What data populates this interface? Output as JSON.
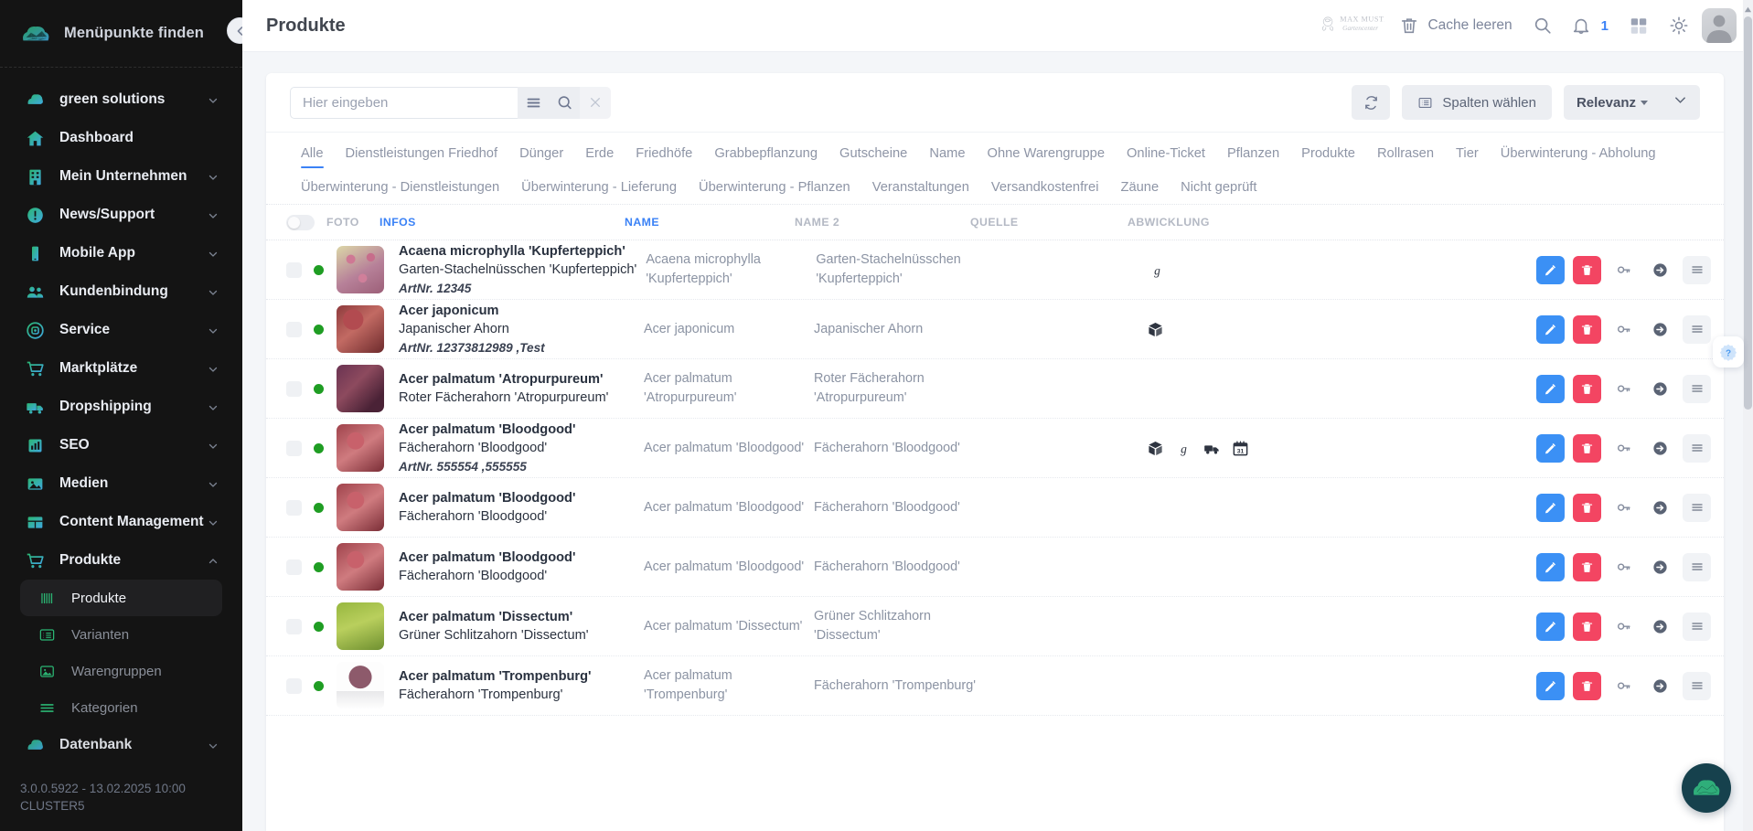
{
  "sidebar": {
    "brand_label": "Menüpunkte finden",
    "items": [
      {
        "label": "green solutions",
        "icon": "cloud-icon",
        "expandable": true
      },
      {
        "label": "Dashboard",
        "icon": "home-icon",
        "expandable": false
      },
      {
        "label": "Mein Unternehmen",
        "icon": "building-icon",
        "expandable": true
      },
      {
        "label": "News/Support",
        "icon": "exclamation-circle-icon",
        "expandable": true
      },
      {
        "label": "Mobile App",
        "icon": "mobile-icon",
        "expandable": true
      },
      {
        "label": "Kundenbindung",
        "icon": "users-icon",
        "expandable": true
      },
      {
        "label": "Service",
        "icon": "lifebuoy-icon",
        "expandable": true
      },
      {
        "label": "Marktplätze",
        "icon": "cart-icon",
        "expandable": true
      },
      {
        "label": "Dropshipping",
        "icon": "truck-icon",
        "expandable": true
      },
      {
        "label": "SEO",
        "icon": "chart-icon",
        "expandable": true
      },
      {
        "label": "Medien",
        "icon": "image-icon",
        "expandable": true
      },
      {
        "label": "Content Management",
        "icon": "table-icon",
        "expandable": true
      },
      {
        "label": "Produkte",
        "icon": "cart-icon",
        "expandable": true,
        "expanded": true
      },
      {
        "label": "Datenbank",
        "icon": "cloud-icon",
        "expandable": true
      }
    ],
    "subitems": [
      {
        "label": "Produkte",
        "icon": "barcode-icon",
        "active": true
      },
      {
        "label": "Varianten",
        "icon": "list-icon",
        "active": false
      },
      {
        "label": "Warengruppen",
        "icon": "image-box-icon",
        "active": false
      },
      {
        "label": "Kategorien",
        "icon": "menu-lines-icon",
        "active": false
      }
    ],
    "version": "3.0.0.5922 - 13.02.2025 10:00\nCLUSTER5"
  },
  "header": {
    "title": "Produkte",
    "company_logo_line1": "MAX MUSTER",
    "company_logo_line2": "Gartencenter",
    "cache_clear_label": "Cache leeren",
    "notification_count": "1"
  },
  "toolbar": {
    "search_placeholder": "Hier eingeben",
    "search_value": "",
    "columns_label": "Spalten wählen",
    "sort_label": "Relevanz"
  },
  "tabs": [
    {
      "label": "Alle",
      "active": true
    },
    {
      "label": "Dienstleistungen Friedhof",
      "active": false
    },
    {
      "label": "Dünger",
      "active": false
    },
    {
      "label": "Erde",
      "active": false
    },
    {
      "label": "Friedhöfe",
      "active": false
    },
    {
      "label": "Grabbepflanzung",
      "active": false
    },
    {
      "label": "Gutscheine",
      "active": false
    },
    {
      "label": "Name",
      "active": false
    },
    {
      "label": "Ohne Warengruppe",
      "active": false
    },
    {
      "label": "Online-Ticket",
      "active": false
    },
    {
      "label": "Pflanzen",
      "active": false
    },
    {
      "label": "Produkte",
      "active": false
    },
    {
      "label": "Rollrasen",
      "active": false
    },
    {
      "label": "Tier",
      "active": false
    },
    {
      "label": "Überwinterung - Abholung",
      "active": false
    },
    {
      "label": "Überwinterung - Dienstleistungen",
      "active": false
    },
    {
      "label": "Überwinterung - Lieferung",
      "active": false
    },
    {
      "label": "Überwinterung - Pflanzen",
      "active": false
    },
    {
      "label": "Veranstaltungen",
      "active": false
    },
    {
      "label": "Versandkostenfrei",
      "active": false
    },
    {
      "label": "Zäune",
      "active": false
    },
    {
      "label": "Nicht geprüft",
      "active": false
    }
  ],
  "table": {
    "columns": [
      {
        "key": "foto",
        "label": "FOTO",
        "highlight": false
      },
      {
        "key": "infos",
        "label": "INFOS",
        "highlight": true
      },
      {
        "key": "name",
        "label": "NAME",
        "highlight": true
      },
      {
        "key": "name2",
        "label": "NAME 2",
        "highlight": false
      },
      {
        "key": "quelle",
        "label": "QUELLE",
        "highlight": false
      },
      {
        "key": "abw",
        "label": "ABWICKLUNG",
        "highlight": false
      }
    ],
    "rows": [
      {
        "info_1": "Acaena microphylla 'Kupferteppich'",
        "info_2": "Garten-Stachelnüsschen 'Kupferteppich'",
        "info_3": "ArtNr. 12345",
        "name": "Acaena microphylla 'Kupferteppich'",
        "name2": "Garten-Stachelnüsschen 'Kupferteppich'",
        "quelle": "",
        "abwicklung": [
          "g-icon"
        ],
        "photo": "pink-flower",
        "status": "active"
      },
      {
        "info_1": "Acer japonicum",
        "info_2": "Japanischer Ahorn",
        "info_3": "ArtNr. 12373812989 ,Test",
        "name": "Acer japonicum",
        "name2": "Japanischer Ahorn",
        "quelle": "",
        "abwicklung": [
          "box-icon"
        ],
        "photo": "red-maple",
        "status": "active"
      },
      {
        "info_1": "Acer palmatum 'Atropurpureum'",
        "info_2": "Roter Fächerahorn 'Atropurpureum'",
        "info_3": "",
        "name": "Acer palmatum 'Atropurpureum'",
        "name2": "Roter Fächerahorn 'Atropurpureum'",
        "quelle": "",
        "abwicklung": [],
        "photo": "purple-maple",
        "status": "active"
      },
      {
        "info_1": "Acer palmatum 'Bloodgood'",
        "info_2": "Fächerahorn 'Bloodgood'",
        "info_3": "ArtNr. 555554 ,555555",
        "name": "Acer palmatum 'Bloodgood'",
        "name2": "Fächerahorn 'Bloodgood'",
        "quelle": "",
        "abwicklung": [
          "box-icon",
          "g-icon",
          "truck-icon",
          "calendar-icon"
        ],
        "photo": "red-leaf",
        "status": "active"
      },
      {
        "info_1": "Acer palmatum 'Bloodgood'",
        "info_2": "Fächerahorn 'Bloodgood'",
        "info_3": "",
        "name": "Acer palmatum 'Bloodgood'",
        "name2": "Fächerahorn 'Bloodgood'",
        "quelle": "",
        "abwicklung": [],
        "photo": "red-leaf",
        "status": "active"
      },
      {
        "info_1": "Acer palmatum 'Bloodgood'",
        "info_2": "Fächerahorn 'Bloodgood'",
        "info_3": "",
        "name": "Acer palmatum 'Bloodgood'",
        "name2": "Fächerahorn 'Bloodgood'",
        "quelle": "",
        "abwicklung": [],
        "photo": "red-leaf",
        "status": "active"
      },
      {
        "info_1": "Acer palmatum 'Dissectum'",
        "info_2": "Grüner Schlitzahorn 'Dissectum'",
        "info_3": "",
        "name": "Acer palmatum 'Dissectum'",
        "name2": "Grüner Schlitzahorn 'Dissectum'",
        "quelle": "",
        "abwicklung": [],
        "photo": "green-maple",
        "status": "active"
      },
      {
        "info_1": "Acer palmatum 'Trompenburg'",
        "info_2": "Fächerahorn 'Trompenburg'",
        "info_3": "",
        "name": "Acer palmatum 'Trompenburg'",
        "name2": "Fächerahorn 'Trompenburg'",
        "quelle": "",
        "abwicklung": [],
        "photo": "tree-plant",
        "status": "active"
      }
    ]
  },
  "colors": {
    "accent_blue": "#3b82f6",
    "edit_blue": "#3b90f5",
    "delete_red": "#f34562",
    "status_green": "#1f9d23",
    "sidebar_bg": "#141414",
    "teal_gradient_start": "#2bb673",
    "teal_gradient_end": "#3fa9e0"
  }
}
